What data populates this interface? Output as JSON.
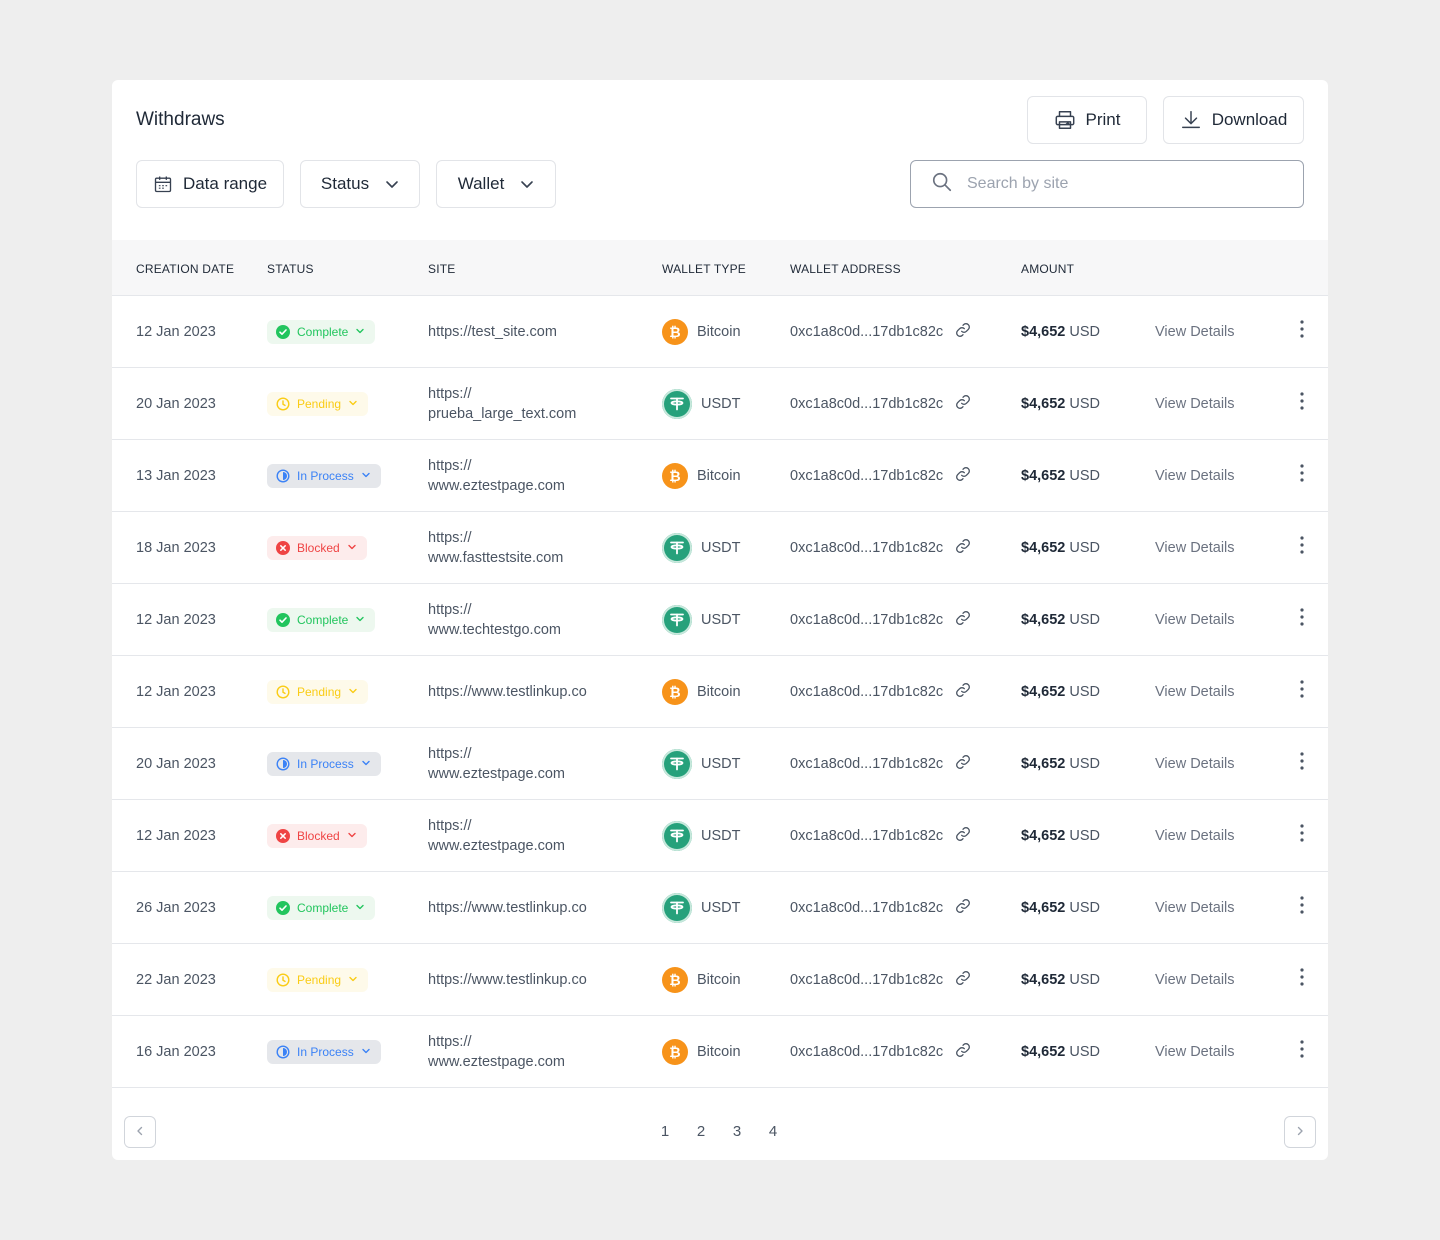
{
  "title": "Withdraws",
  "actions": {
    "print": "Print",
    "download": "Download"
  },
  "filters": {
    "date": "Data range",
    "status": "Status",
    "wallet": "Wallet"
  },
  "search": {
    "placeholder": "Search by site",
    "value": ""
  },
  "columns": [
    "CREATION DATE",
    "STATUS",
    "SITE",
    "WALLET TYPE",
    "WALLET ADDRESS",
    "AMOUNT"
  ],
  "rows": [
    {
      "date": "12 Jan 2023",
      "status": "Complete",
      "site1": "https://test_site.com",
      "site2": "",
      "wallet": "Bitcoin",
      "address": "0xc1a8c0d...17db1c82c",
      "amount": "$4,652",
      "currency": "USD",
      "view": "View Details"
    },
    {
      "date": "20 Jan 2023",
      "status": "Pending",
      "site1": "https://",
      "site2": "prueba_large_text.com",
      "wallet": "USDT",
      "address": "0xc1a8c0d...17db1c82c",
      "amount": "$4,652",
      "currency": "USD",
      "view": "View Details"
    },
    {
      "date": "13 Jan 2023",
      "status": "In Process",
      "site1": "https://",
      "site2": "www.eztestpage.com",
      "wallet": "Bitcoin",
      "address": "0xc1a8c0d...17db1c82c",
      "amount": "$4,652",
      "currency": "USD",
      "view": "View Details"
    },
    {
      "date": "18 Jan 2023",
      "status": "Blocked",
      "site1": "https://",
      "site2": "www.fasttestsite.com",
      "wallet": "USDT",
      "address": "0xc1a8c0d...17db1c82c",
      "amount": "$4,652",
      "currency": "USD",
      "view": "View Details"
    },
    {
      "date": "12 Jan 2023",
      "status": "Complete",
      "site1": "https://",
      "site2": "www.techtestgo.com",
      "wallet": "USDT",
      "address": "0xc1a8c0d...17db1c82c",
      "amount": "$4,652",
      "currency": "USD",
      "view": "View Details"
    },
    {
      "date": "12 Jan 2023",
      "status": "Pending",
      "site1": "https://www.testlinkup.co",
      "site2": "",
      "wallet": "Bitcoin",
      "address": "0xc1a8c0d...17db1c82c",
      "amount": "$4,652",
      "currency": "USD",
      "view": "View Details"
    },
    {
      "date": "20 Jan 2023",
      "status": "In Process",
      "site1": "https://",
      "site2": "www.eztestpage.com",
      "wallet": "USDT",
      "address": "0xc1a8c0d...17db1c82c",
      "amount": "$4,652",
      "currency": "USD",
      "view": "View Details"
    },
    {
      "date": "12 Jan 2023",
      "status": "Blocked",
      "site1": "https://",
      "site2": "www.eztestpage.com",
      "wallet": "USDT",
      "address": "0xc1a8c0d...17db1c82c",
      "amount": "$4,652",
      "currency": "USD",
      "view": "View Details"
    },
    {
      "date": "26 Jan 2023",
      "status": "Complete",
      "site1": "https://www.testlinkup.co",
      "site2": "",
      "wallet": "USDT",
      "address": "0xc1a8c0d...17db1c82c",
      "amount": "$4,652",
      "currency": "USD",
      "view": "View Details"
    },
    {
      "date": "22 Jan 2023",
      "status": "Pending",
      "site1": "https://www.testlinkup.co",
      "site2": "",
      "wallet": "Bitcoin",
      "address": "0xc1a8c0d...17db1c82c",
      "amount": "$4,652",
      "currency": "USD",
      "view": "View Details"
    },
    {
      "date": "16 Jan 2023",
      "status": "In Process",
      "site1": "https://",
      "site2": "www.eztestpage.com",
      "wallet": "Bitcoin",
      "address": "0xc1a8c0d...17db1c82c",
      "amount": "$4,652",
      "currency": "USD",
      "view": "View Details"
    }
  ],
  "pagination": {
    "pages": [
      "1",
      "2",
      "3",
      "4"
    ]
  },
  "colors": {
    "complete": "#22c55e",
    "pending": "#facc15",
    "in_process": "#3b82f6",
    "blocked": "#ef4444",
    "bitcoin": "#f7931a",
    "usdt": "#26a17b"
  }
}
